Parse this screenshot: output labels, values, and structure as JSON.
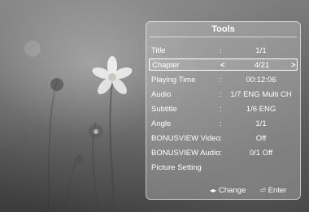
{
  "panel": {
    "title": "Tools",
    "rows": [
      {
        "label": "Title",
        "colon": ":",
        "value": "1/1"
      },
      {
        "label": "Chapter",
        "colon": "<",
        "value": "4/21",
        "right": ">"
      },
      {
        "label": "Playing Time",
        "colon": ":",
        "value": "00:12:06"
      },
      {
        "label": "Audio",
        "colon": ":",
        "value": "1/7 ENG Multi CH"
      },
      {
        "label": "Subtitle",
        "colon": ":",
        "value": "1/6 ENG"
      },
      {
        "label": "Angle",
        "colon": ":",
        "value": "1/1"
      },
      {
        "label": "BONUSVIEW Video",
        "colon": ":",
        "value": "Off"
      },
      {
        "label": "BONUSVIEW Audio",
        "colon": ":",
        "value": "0/1 Off"
      },
      {
        "label": "Picture Setting",
        "colon": "",
        "value": ""
      }
    ],
    "footer": {
      "change_label": "Change",
      "change_icon": "left-right-arrows-icon",
      "enter_label": "Enter",
      "enter_icon": "enter-icon"
    }
  }
}
